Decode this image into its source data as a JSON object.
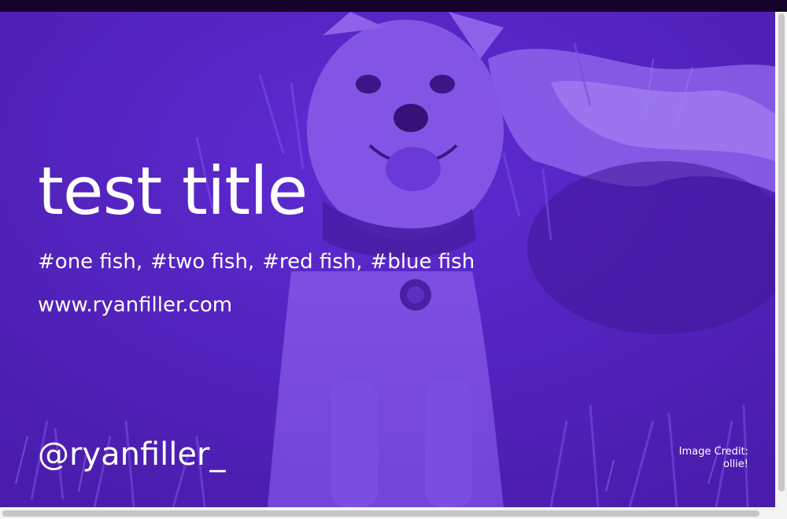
{
  "card": {
    "title": "test title",
    "tags": [
      "#one fish,",
      "#two fish,",
      "#red fish,",
      "#blue fish"
    ],
    "url": "www.ryanfiller.com",
    "handle": "@ryanfiller_",
    "credit_line1": "Image Credit:",
    "credit_line2": "ollie!"
  },
  "colors": {
    "overlay": "#6a2fe0",
    "text": "#ffffff",
    "top_bar": "#140028"
  }
}
